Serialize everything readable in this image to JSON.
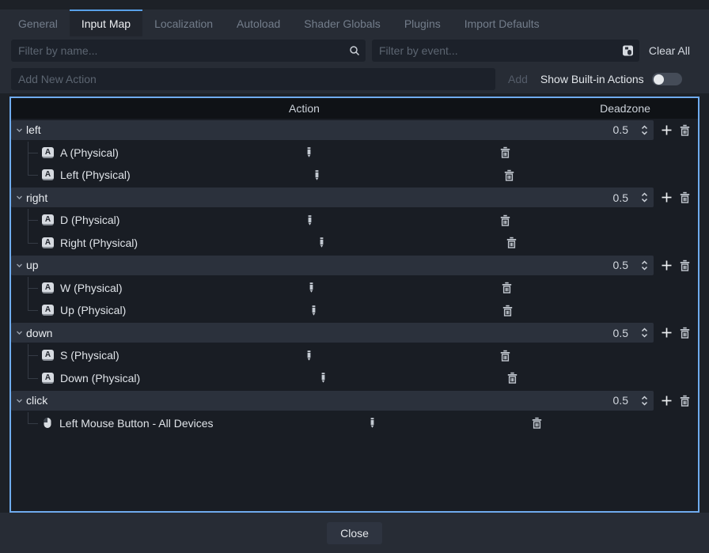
{
  "tabs": {
    "items": [
      {
        "label": "General",
        "active": false
      },
      {
        "label": "Input Map",
        "active": true
      },
      {
        "label": "Localization",
        "active": false
      },
      {
        "label": "Autoload",
        "active": false
      },
      {
        "label": "Shader Globals",
        "active": false
      },
      {
        "label": "Plugins",
        "active": false
      },
      {
        "label": "Import Defaults",
        "active": false
      }
    ]
  },
  "filters": {
    "name_placeholder": "Filter by name...",
    "event_placeholder": "Filter by event...",
    "clear_all_label": "Clear All"
  },
  "add_action": {
    "placeholder": "Add New Action",
    "add_label": "Add",
    "show_builtin_label": "Show Built-in Actions",
    "toggle_state": "off"
  },
  "table": {
    "headers": {
      "action": "Action",
      "deadzone": "Deadzone"
    },
    "key_glyph": "A",
    "rows": [
      {
        "type": "action",
        "label": "left",
        "deadzone": "0.5"
      },
      {
        "type": "event",
        "icon": "key",
        "label": "A (Physical)"
      },
      {
        "type": "event",
        "icon": "key",
        "label": "Left (Physical)"
      },
      {
        "type": "action",
        "label": "right",
        "deadzone": "0.5"
      },
      {
        "type": "event",
        "icon": "key",
        "label": "D (Physical)"
      },
      {
        "type": "event",
        "icon": "key",
        "label": "Right (Physical)"
      },
      {
        "type": "action",
        "label": "up",
        "deadzone": "0.5"
      },
      {
        "type": "event",
        "icon": "key",
        "label": "W (Physical)"
      },
      {
        "type": "event",
        "icon": "key",
        "label": "Up (Physical)"
      },
      {
        "type": "action",
        "label": "down",
        "deadzone": "0.5"
      },
      {
        "type": "event",
        "icon": "key",
        "label": "S (Physical)"
      },
      {
        "type": "event",
        "icon": "key",
        "label": "Down (Physical)"
      },
      {
        "type": "action",
        "label": "click",
        "deadzone": "0.5"
      },
      {
        "type": "event",
        "icon": "mouse",
        "label": "Left Mouse Button - All Devices"
      }
    ]
  },
  "footer": {
    "close_label": "Close"
  },
  "colors": {
    "accent_blue": "#58a0e8",
    "table_border": "#6fabee",
    "dialog_bg": "#272c35",
    "input_bg": "#1c212a",
    "table_bg": "#191d24",
    "header_row_bg": "#0f1216",
    "action_row_bg": "#2b313c",
    "text_primary": "#dfe3e8",
    "text_muted": "#737d8b",
    "text_disabled": "#545c69"
  }
}
